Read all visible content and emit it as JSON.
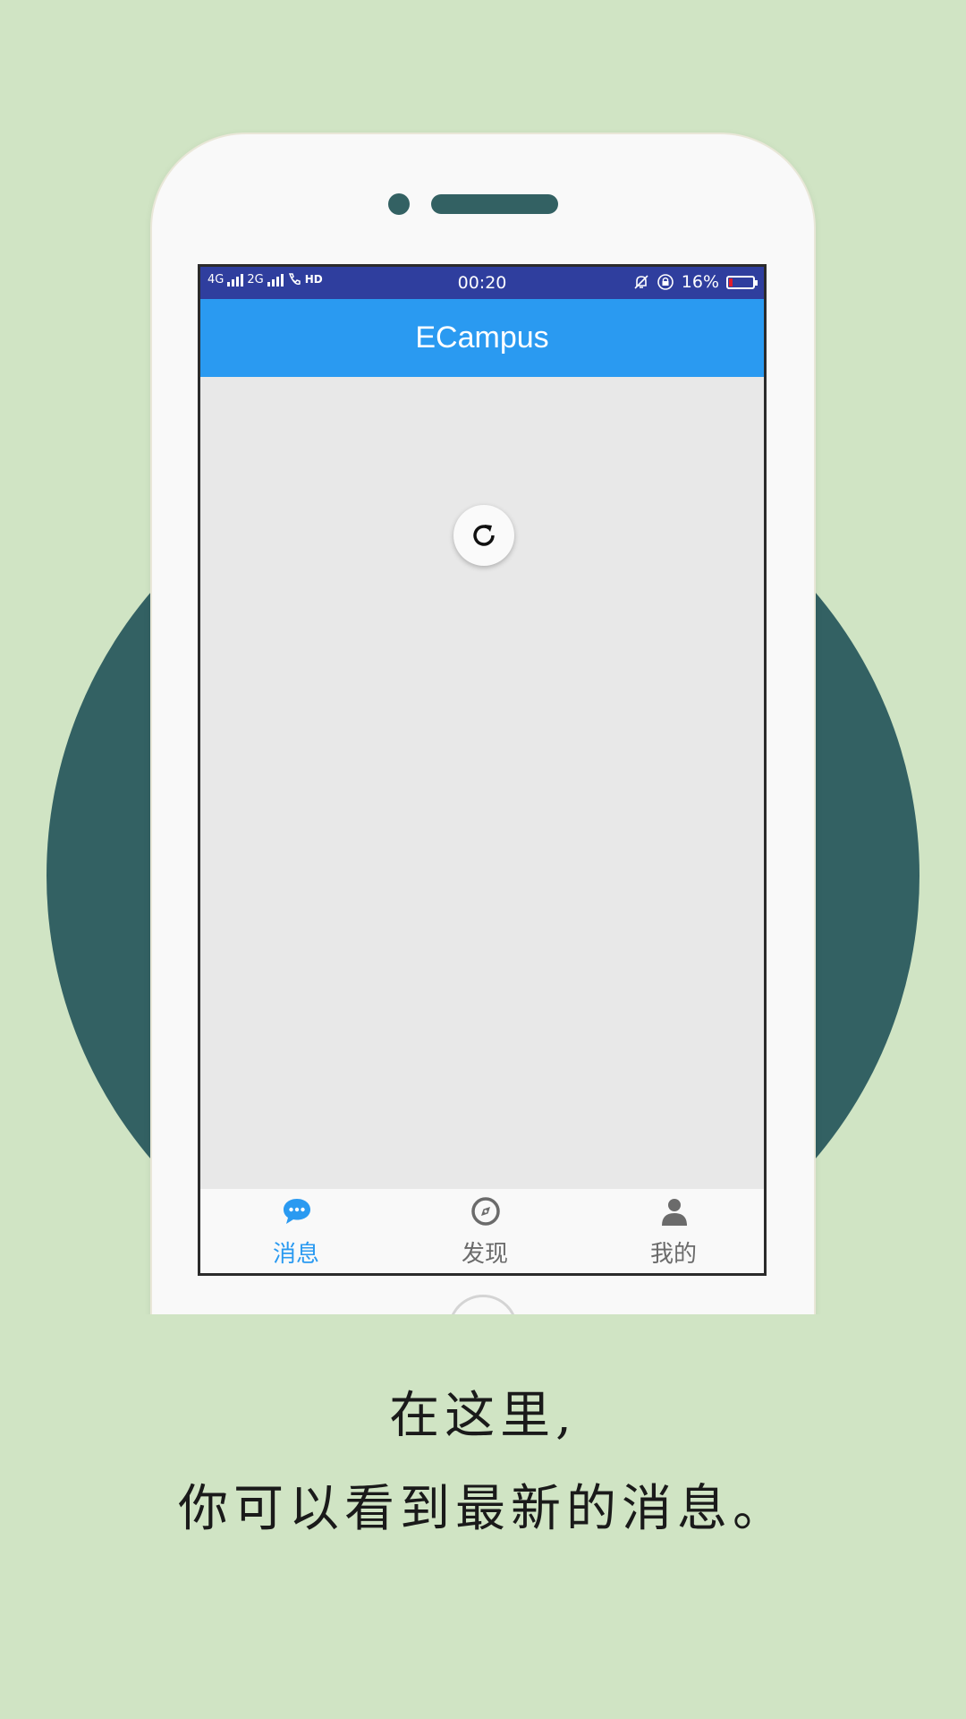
{
  "status_bar": {
    "network_left": "4G",
    "network_right": "2G",
    "hd": "HD",
    "time": "00:20",
    "battery_percent": "16%",
    "battery_level": 0.16,
    "battery_color": "#e21b2a"
  },
  "app_bar": {
    "title": "ECampus",
    "color": "#2a9af1"
  },
  "loading": {
    "icon": "refresh-icon"
  },
  "tabs": [
    {
      "label": "消息",
      "icon": "chat-bubble-icon",
      "active": true
    },
    {
      "label": "发现",
      "icon": "compass-icon",
      "active": false
    },
    {
      "label": "我的",
      "icon": "person-icon",
      "active": false
    }
  ],
  "caption": {
    "line1": "在这里,",
    "line2": "你可以看到最新的消息。"
  },
  "colors": {
    "background": "#d0e4c4",
    "circle": "#336163",
    "status_bar": "#2f3e9e"
  }
}
